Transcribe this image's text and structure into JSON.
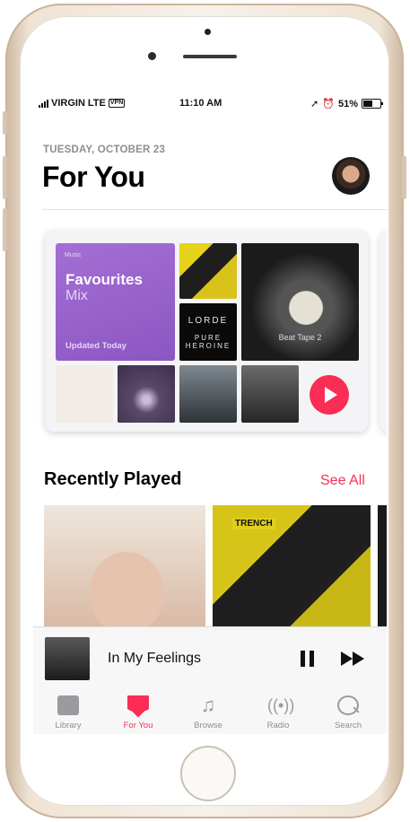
{
  "status_bar": {
    "carrier": "VIRGIN",
    "network": "LTE",
    "time": "11:10 AM",
    "battery": "51%"
  },
  "header": {
    "date": "TUESDAY, OCTOBER 23",
    "title": "For You"
  },
  "mix_card": {
    "brand": "Music",
    "title": "Favourites",
    "subtitle": "Mix",
    "updated": "Updated Today",
    "album_lorde_top": "LORDE",
    "album_lorde_bottom": "PURE HEROINE",
    "album_beat_tape": "Beat Tape 2"
  },
  "recently_played": {
    "title": "Recently Played",
    "see_all": "See All",
    "album2_label": "TRENCH"
  },
  "now_playing": {
    "song": "In My Feelings"
  },
  "tabs": [
    {
      "label": "Library"
    },
    {
      "label": "For You"
    },
    {
      "label": "Browse"
    },
    {
      "label": "Radio"
    },
    {
      "label": "Search"
    }
  ],
  "colors": {
    "accent": "#fa2d55",
    "mix_purple": "#9a63cc",
    "phone_gold": "#efe3d4"
  }
}
